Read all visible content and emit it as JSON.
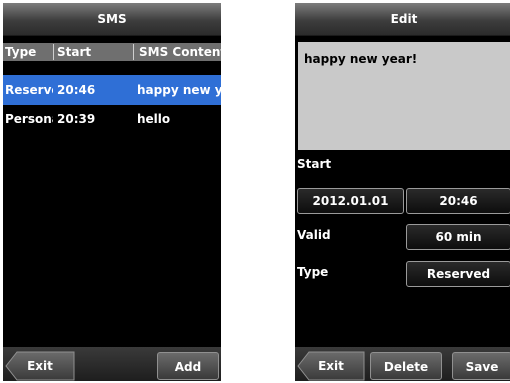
{
  "sms_list": {
    "title": "SMS",
    "columns": [
      "Type",
      "Start",
      "SMS Content"
    ],
    "rows": [
      {
        "type": "Reserved",
        "start": "20:46",
        "content": "happy new year!"
      },
      {
        "type": "Personal",
        "start": "20:39",
        "content": "hello"
      }
    ],
    "buttons": {
      "exit": "Exit",
      "add": "Add"
    }
  },
  "edit": {
    "title": "Edit",
    "content": "happy new year!",
    "start_label": "Start",
    "start_date": "2012.01.01",
    "start_time": "20:46",
    "valid_label": "Valid",
    "valid_value": "60 min",
    "type_label": "Type",
    "type_value": "Reserved",
    "buttons": {
      "exit": "Exit",
      "delete": "Delete",
      "save": "Save"
    }
  },
  "colors": {
    "selected_row": "#2f6fd6",
    "header_bg": "#6f6f6f",
    "content_bg": "#c9c9c9"
  }
}
